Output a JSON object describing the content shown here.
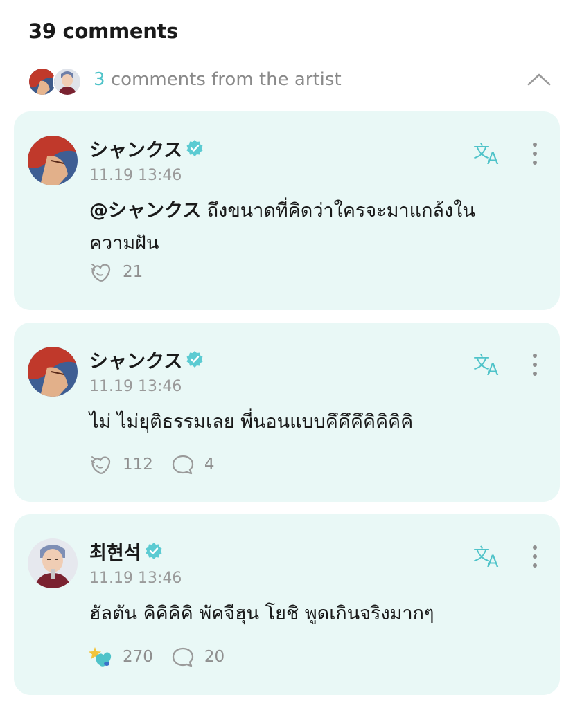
{
  "header": {
    "title": "39 comments"
  },
  "artist_summary": {
    "count": "3",
    "label": "comments from the artist"
  },
  "colors": {
    "accent": "#4fc3c9",
    "card_bg": "#e9f8f6",
    "muted": "#8f8f8f"
  },
  "comments": [
    {
      "author": "シャンクス",
      "verified": true,
      "time": "11.19 13:46",
      "mention": "@シャンクス",
      "text": " ถึงขนาดที่คิดว่าใครจะมาแกล้งใน ความฝัน",
      "reaction_icon": "heart-outline-icon",
      "reactions": "21",
      "replies": null
    },
    {
      "author": "シャンクス",
      "verified": true,
      "time": "11.19 13:46",
      "mention": "",
      "text": "ไม่ ไม่ยุติธรรมเลย พี่นอนแบบคึคึคึคิคิคิคิ",
      "reaction_icon": "heart-outline-icon",
      "reactions": "112",
      "replies": "4"
    },
    {
      "author": "최현석",
      "verified": true,
      "time": "11.19 13:46",
      "mention": "",
      "text": "ฮัลตัน คิคิคิคิ พัคจีฮุน โยชิ พูดเกินจริงมากๆ",
      "reaction_icon": "colored-reaction-icon",
      "reactions": "270",
      "replies": "20"
    }
  ]
}
